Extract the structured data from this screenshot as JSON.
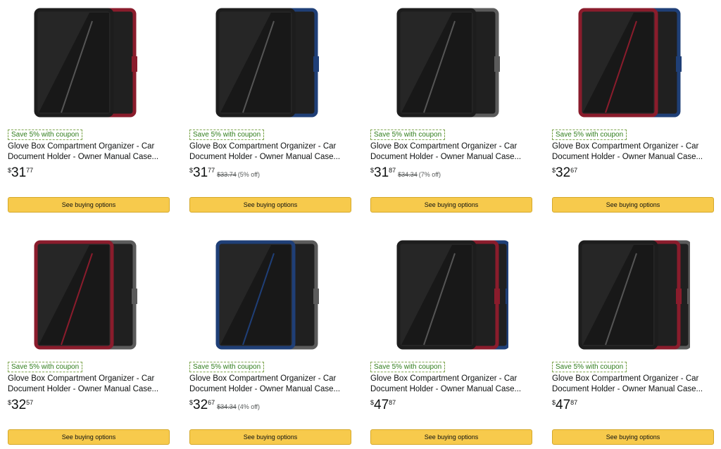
{
  "products": [
    {
      "coupon": "Save 5% with coupon",
      "title_line1": "Glove Box Compartment Organizer - Car",
      "title_line2": "Document Holder - Owner Manual Case...",
      "currency": "$",
      "price_whole": "31",
      "price_fraction": "77",
      "was_price": "",
      "discount": "",
      "button_label": "See buying options",
      "colors": [
        "#1d1d1d",
        "#8a1c2c"
      ]
    },
    {
      "coupon": "Save 5% with coupon",
      "title_line1": "Glove Box Compartment Organizer - Car",
      "title_line2": "Document Holder - Owner Manual Case...",
      "currency": "$",
      "price_whole": "31",
      "price_fraction": "77",
      "was_price": "$33.74",
      "discount": "(5% off)",
      "button_label": "See buying options",
      "colors": [
        "#1d1d1d",
        "#1f3f77"
      ]
    },
    {
      "coupon": "Save 5% with coupon",
      "title_line1": "Glove Box Compartment Organizer - Car",
      "title_line2": "Document Holder - Owner Manual Case...",
      "currency": "$",
      "price_whole": "31",
      "price_fraction": "87",
      "was_price": "$34.34",
      "discount": "(7% off)",
      "button_label": "See buying options",
      "colors": [
        "#1d1d1d",
        "#5b5b5b"
      ]
    },
    {
      "coupon": "Save 5% with coupon",
      "title_line1": "Glove Box Compartment Organizer - Car",
      "title_line2": "Document Holder - Owner Manual Case...",
      "currency": "$",
      "price_whole": "32",
      "price_fraction": "67",
      "was_price": "",
      "discount": "",
      "button_label": "See buying options",
      "colors": [
        "#8a1c2c",
        "#1f3f77"
      ]
    },
    {
      "coupon": "Save 5% with coupon",
      "title_line1": "Glove Box Compartment Organizer - Car",
      "title_line2": "Document Holder - Owner Manual Case...",
      "currency": "$",
      "price_whole": "32",
      "price_fraction": "57",
      "was_price": "",
      "discount": "",
      "button_label": "See buying options",
      "colors": [
        "#8a1c2c",
        "#5b5b5b"
      ]
    },
    {
      "coupon": "Save 5% with coupon",
      "title_line1": "Glove Box Compartment Organizer - Car",
      "title_line2": "Document Holder - Owner Manual Case...",
      "currency": "$",
      "price_whole": "32",
      "price_fraction": "67",
      "was_price": "$34.34",
      "discount": "(4% off)",
      "button_label": "See buying options",
      "colors": [
        "#1f3f77",
        "#5b5b5b"
      ]
    },
    {
      "coupon": "Save 5% with coupon",
      "title_line1": "Glove Box Compartment Organizer - Car",
      "title_line2": "Document Holder - Owner Manual Case...",
      "currency": "$",
      "price_whole": "47",
      "price_fraction": "87",
      "was_price": "",
      "discount": "",
      "button_label": "See buying options",
      "colors": [
        "#1d1d1d",
        "#8a1c2c",
        "#1f3f77"
      ]
    },
    {
      "coupon": "Save 5% with coupon",
      "title_line1": "Glove Box Compartment Organizer - Car",
      "title_line2": "Document Holder - Owner Manual Case...",
      "currency": "$",
      "price_whole": "47",
      "price_fraction": "87",
      "was_price": "",
      "discount": "",
      "button_label": "See buying options",
      "colors": [
        "#1d1d1d",
        "#8a1c2c",
        "#5b5b5b"
      ]
    }
  ]
}
